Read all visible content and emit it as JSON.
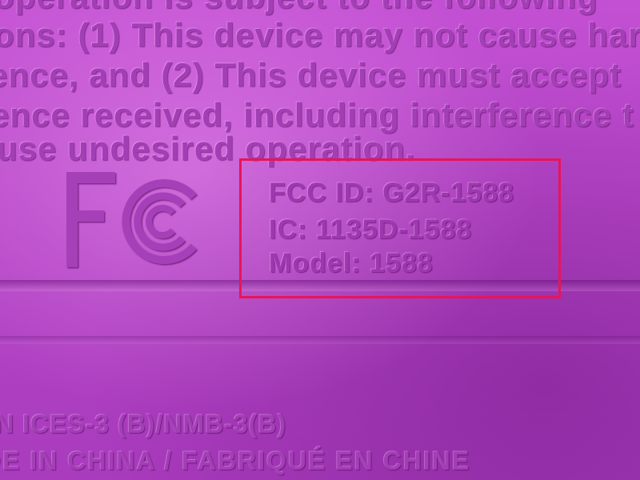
{
  "label_text": {
    "paragraph_lines": [
      "operation is subject to the following",
      "ons: (1) This device may not cause har",
      "ence, and (2) This device must accept",
      "ence received, including interference t",
      "use undesired operation."
    ],
    "identifiers": [
      "FCC ID: G2R-1588",
      "IC: 1135D-1588",
      "Model: 1588"
    ],
    "footer_lines": [
      "N ICES-3 (B)/NMB-3(B)",
      "DE IN CHINA  /  FABRIQUÉ EN CHINE"
    ]
  },
  "logo": {
    "text": "FC",
    "icon": "fcc-logo-icon"
  },
  "colors": {
    "plastic": "#b545c7",
    "emboss": "#a23fb5",
    "highlight_box": "#e8145a"
  }
}
